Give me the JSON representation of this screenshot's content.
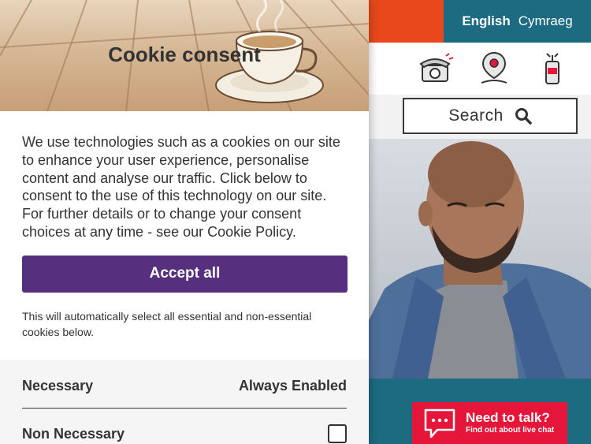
{
  "site": {
    "languages": [
      {
        "label": "English",
        "active": true
      },
      {
        "label": "Cymraeg",
        "active": false
      }
    ],
    "icons": [
      "telephone-icon",
      "map-pin-icon",
      "tin-can-phone-icon"
    ],
    "search": {
      "label": "Search",
      "icon": "search-icon"
    },
    "chat": {
      "title": "Need to talk?",
      "subtitle": "Find out about live chat",
      "icon": "chat-bubble-icon"
    },
    "colors": {
      "orange": "#e8481b",
      "teal": "#1c6b80",
      "chat_red": "#e5163a"
    }
  },
  "cookie_dialog": {
    "title": "Cookie consent",
    "description": "We use technologies such as a cookies on our site to enhance your user experience, personalise content and analyse our traffic. Click below to consent to the use of this technology on our site. For further details or to change your consent choices at any time - see our Cookie Policy.",
    "accept_label": "Accept all",
    "auto_select_note": "This will automatically select all essential and non-essential cookies below.",
    "categories": [
      {
        "name": "Necessary",
        "status": "Always Enabled"
      },
      {
        "name": "Non Necessary",
        "checked": false
      }
    ],
    "colors": {
      "accept_button": "#56307f"
    }
  }
}
